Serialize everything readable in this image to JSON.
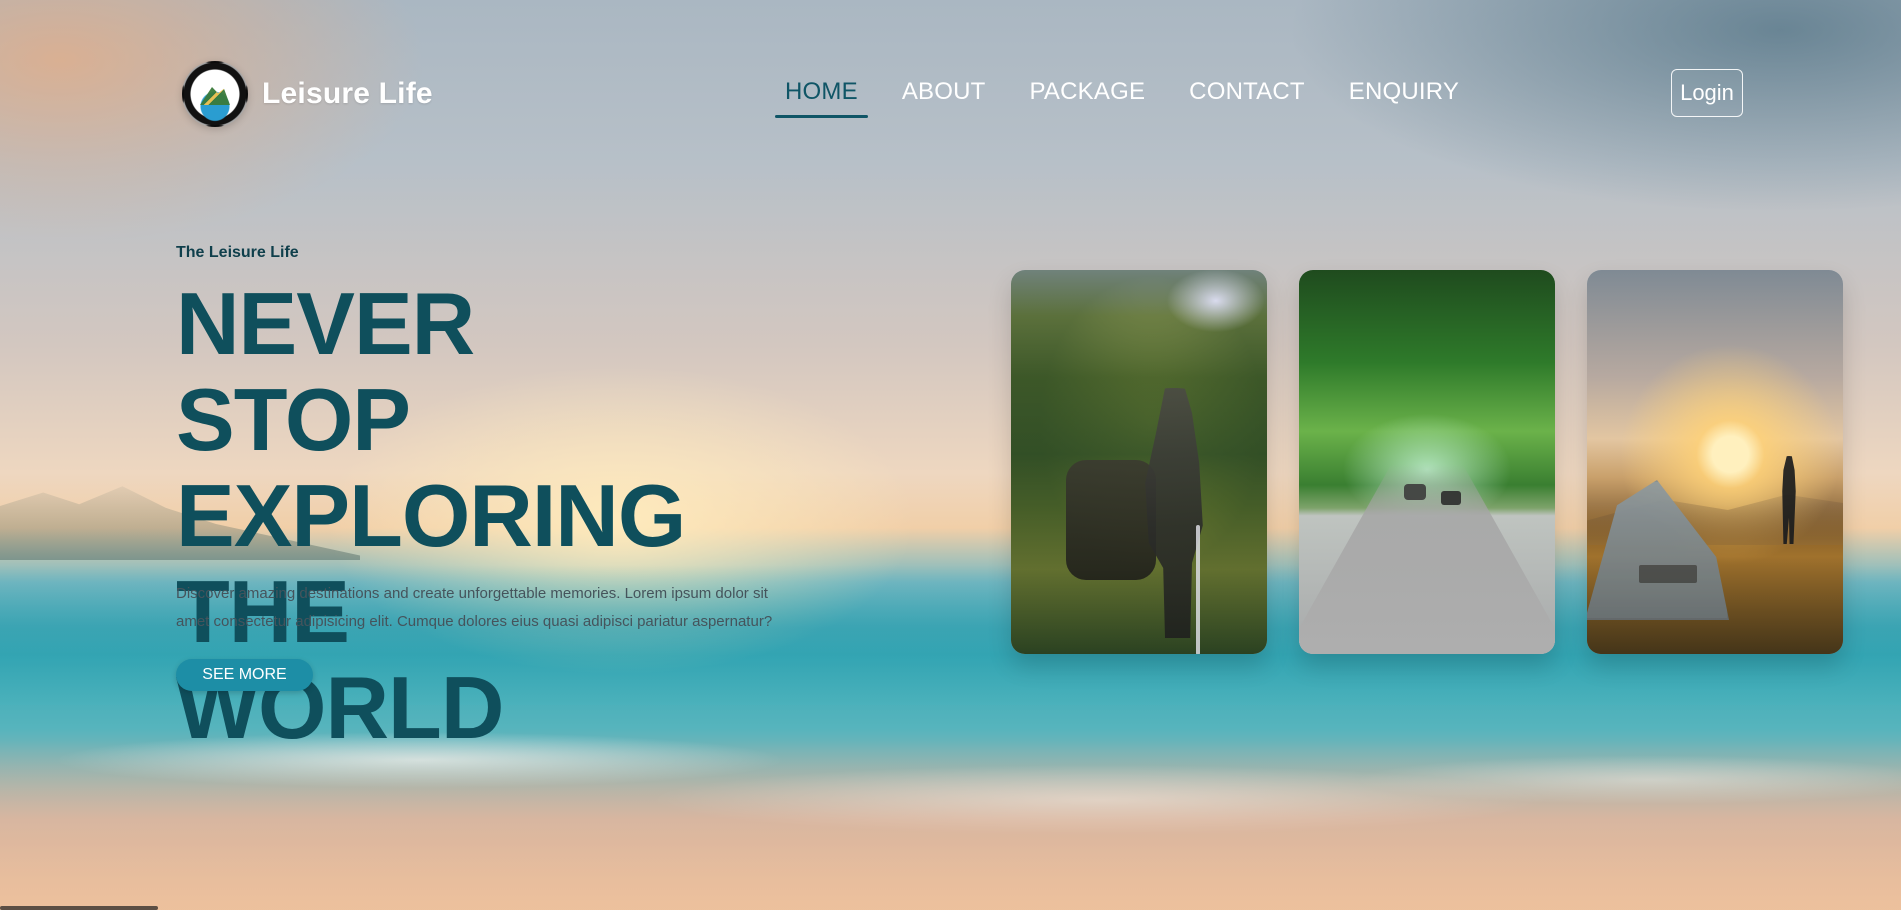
{
  "brand": {
    "name": "Leisure Life"
  },
  "nav": {
    "items": [
      {
        "label": "HOME"
      },
      {
        "label": "ABOUT"
      },
      {
        "label": "PACKAGE"
      },
      {
        "label": "CONTACT"
      },
      {
        "label": "ENQUIRY"
      }
    ],
    "active": "HOME"
  },
  "auth": {
    "login_label": "Login"
  },
  "hero": {
    "eyebrow": "The Leisure Life",
    "headline": "NEVER STOP EXPLORING THE WORLD",
    "description": "Discover amazing destinations and create unforgettable memories. Lorem ipsum dolor sit amet consectetur adipisicing elit. Cumque dolores eius quasi adipisci pariatur aspernatur?",
    "cta_label": "SEE MORE"
  },
  "colors": {
    "headline": "#0f4f5c",
    "nav_active": "#0f5566",
    "cta": "#1d8ea6"
  },
  "icons": {
    "logo": "brand-logo-icon"
  }
}
